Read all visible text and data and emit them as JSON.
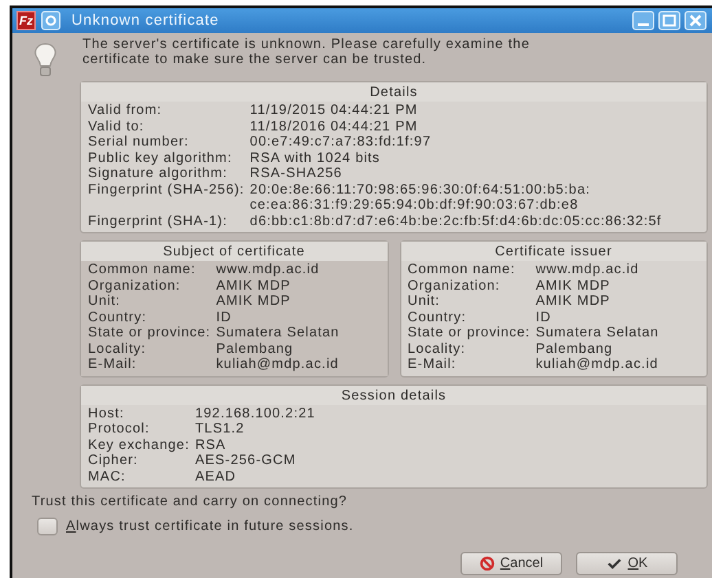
{
  "window": {
    "logo": "Fz",
    "title": "Unknown certificate"
  },
  "message": "The server's certificate is unknown. Please carefully examine the certificate to make sure the server can be trusted.",
  "details": {
    "title": "Details",
    "rows": [
      {
        "label": "Valid from:",
        "value": "11/19/2015 04:44:21 PM"
      },
      {
        "label": "Valid to:",
        "value": "11/18/2016 04:44:21 PM"
      },
      {
        "label": "Serial number:",
        "value": "00:e7:49:c7:a7:83:fd:1f:97"
      },
      {
        "label": "Public key algorithm:",
        "value": "RSA with 1024 bits"
      },
      {
        "label": "Signature algorithm:",
        "value": "RSA-SHA256"
      },
      {
        "label": "Fingerprint (SHA-256):",
        "value": "20:0e:8e:66:11:70:98:65:96:30:0f:64:51:00:b5:ba:\nce:ea:86:31:f9:29:65:94:0b:df:9f:90:03:67:db:e8"
      },
      {
        "label": "Fingerprint (SHA-1):",
        "value": "d6:bb:c1:8b:d7:d7:e6:4b:be:2c:fb:5f:d4:6b:dc:05:cc:86:32:5f"
      }
    ]
  },
  "panels": [
    {
      "title": "Subject of certificate",
      "selected": true,
      "rows": [
        {
          "label": "Common name:",
          "value": "www.mdp.ac.id"
        },
        {
          "label": "Organization:",
          "value": "AMIK MDP"
        },
        {
          "label": "Unit:",
          "value": "AMIK MDP"
        },
        {
          "label": "Country:",
          "value": "ID"
        },
        {
          "label": "State or province:",
          "value": "Sumatera Selatan"
        },
        {
          "label": "Locality:",
          "value": "Palembang"
        },
        {
          "label": "E-Mail:",
          "value": "kuliah@mdp.ac.id"
        }
      ]
    },
    {
      "title": "Certificate issuer",
      "selected": false,
      "rows": [
        {
          "label": "Common name:",
          "value": "www.mdp.ac.id"
        },
        {
          "label": "Organization:",
          "value": "AMIK MDP"
        },
        {
          "label": "Unit:",
          "value": "AMIK MDP"
        },
        {
          "label": "Country:",
          "value": "ID"
        },
        {
          "label": "State or province:",
          "value": "Sumatera Selatan"
        },
        {
          "label": "Locality:",
          "value": "Palembang"
        },
        {
          "label": "E-Mail:",
          "value": "kuliah@mdp.ac.id"
        }
      ]
    }
  ],
  "session": {
    "title": "Session details",
    "rows": [
      {
        "label": "Host:",
        "value": "192.168.100.2:21"
      },
      {
        "label": "Protocol:",
        "value": "TLS1.2"
      },
      {
        "label": "Key exchange:",
        "value": "RSA"
      },
      {
        "label": "Cipher:",
        "value": "AES-256-GCM"
      },
      {
        "label": "MAC:",
        "value": "AEAD"
      }
    ]
  },
  "question": "Trust this certificate and carry on connecting?",
  "always_trust": {
    "label": "Always trust certificate in future sessions.",
    "checked": false
  },
  "buttons": [
    {
      "kind": "cancel",
      "label": "Cancel"
    },
    {
      "kind": "ok",
      "label": "OK"
    }
  ]
}
